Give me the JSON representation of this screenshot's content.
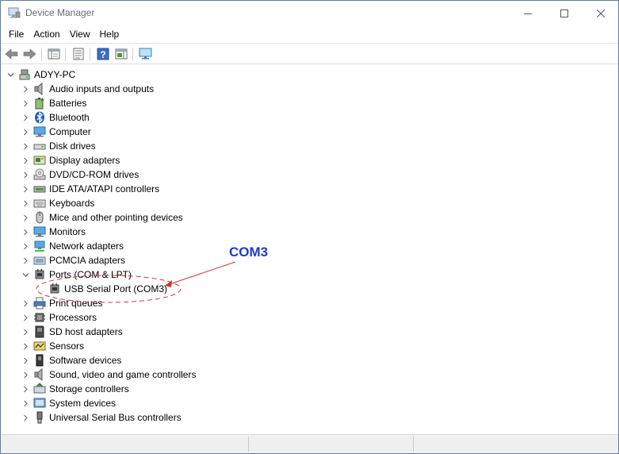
{
  "window": {
    "title": "Device Manager"
  },
  "menu": [
    "File",
    "Action",
    "View",
    "Help"
  ],
  "tree": {
    "root": "ADYY-PC",
    "categories": [
      {
        "label": "Audio inputs and outputs",
        "icon": "speaker-icon"
      },
      {
        "label": "Batteries",
        "icon": "battery-icon"
      },
      {
        "label": "Bluetooth",
        "icon": "bluetooth-icon"
      },
      {
        "label": "Computer",
        "icon": "computer-icon"
      },
      {
        "label": "Disk drives",
        "icon": "disk-drive-icon"
      },
      {
        "label": "Display adapters",
        "icon": "display-adapter-icon"
      },
      {
        "label": "DVD/CD-ROM drives",
        "icon": "dvd-drive-icon"
      },
      {
        "label": "IDE ATA/ATAPI controllers",
        "icon": "ide-controller-icon"
      },
      {
        "label": "Keyboards",
        "icon": "keyboard-icon"
      },
      {
        "label": "Mice and other pointing devices",
        "icon": "mouse-icon"
      },
      {
        "label": "Monitors",
        "icon": "monitor-icon"
      },
      {
        "label": "Network adapters",
        "icon": "network-adapter-icon"
      },
      {
        "label": "PCMCIA adapters",
        "icon": "pcmcia-icon"
      },
      {
        "label": "Ports (COM & LPT)",
        "icon": "port-icon",
        "expanded": true,
        "children": [
          {
            "label": "USB Serial Port (COM3)",
            "icon": "port-icon"
          }
        ]
      },
      {
        "label": "Print queues",
        "icon": "printer-icon"
      },
      {
        "label": "Processors",
        "icon": "processor-icon"
      },
      {
        "label": "SD host adapters",
        "icon": "sd-card-icon"
      },
      {
        "label": "Sensors",
        "icon": "sensor-icon"
      },
      {
        "label": "Software devices",
        "icon": "software-device-icon"
      },
      {
        "label": "Sound, video and game controllers",
        "icon": "sound-icon"
      },
      {
        "label": "Storage controllers",
        "icon": "storage-controller-icon"
      },
      {
        "label": "System devices",
        "icon": "system-device-icon"
      },
      {
        "label": "Universal Serial Bus controllers",
        "icon": "usb-icon"
      }
    ]
  },
  "annotation": {
    "label": "COM3",
    "color": "#1b39d6",
    "arrow_color": "#e0302a"
  }
}
